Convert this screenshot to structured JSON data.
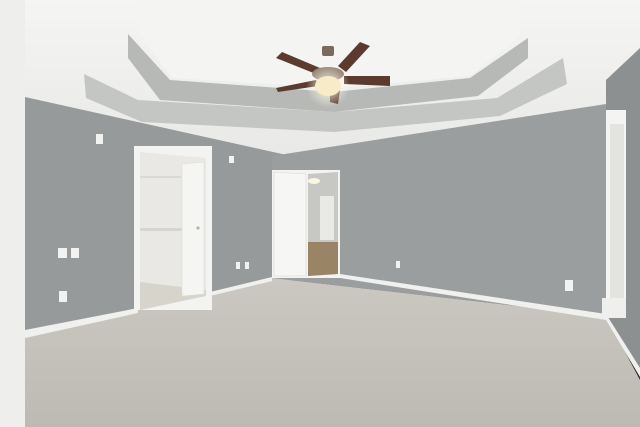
{
  "scene": {
    "colors": {
      "wall": "#979b9b",
      "wall_shadow": "#8b8f8f",
      "ceiling": "#f2f2f0",
      "tray_band": "#b4b7b4",
      "carpet": "#c4c1ba",
      "trim": "#f5f5f3",
      "door": "#f4f4f2",
      "fan_blade": "#5a3b2d",
      "fan_light": "#f7e9c4",
      "hall_floor": "#9a8466"
    },
    "objects": [
      "ceiling-fan",
      "open-closet-door",
      "hallway-door",
      "window",
      "carpet-floor",
      "wall-outlets",
      "light-switches"
    ]
  }
}
